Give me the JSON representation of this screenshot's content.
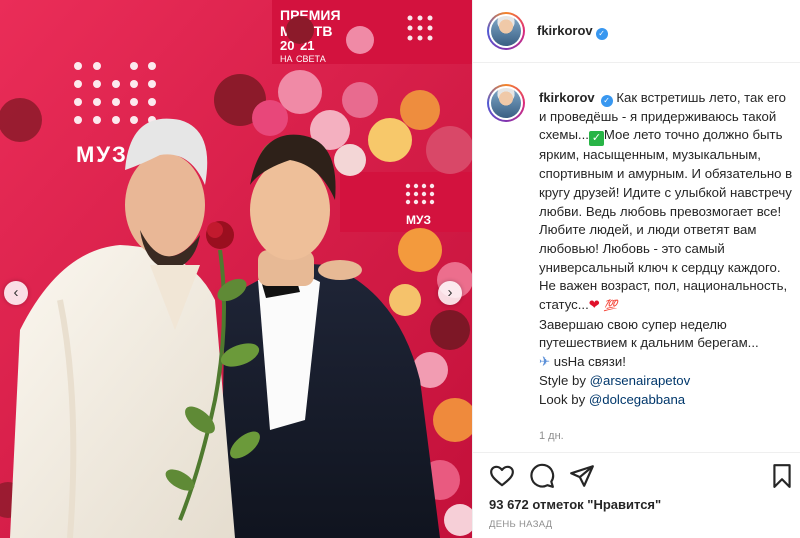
{
  "account": {
    "username": "fkirkorov",
    "verified": true
  },
  "photo": {
    "backdrop_text_1": "ПРЕМИЯ",
    "backdrop_text_2": "МУЗ-ТВ",
    "backdrop_text_3": "20",
    "backdrop_text_4": "21",
    "backdrop_text_5": "НА",
    "backdrop_text_6": "СВЕТА",
    "logo_text": "МУЗ",
    "logo_text_small": "МУЗ",
    "accent_color": "#d81743"
  },
  "caption": {
    "line_1": "Как встретишь лето, так",
    "line_2": "его и проведёшь - я придерживаюсь",
    "line_3a": "такой схемы...",
    "line_3b": "Мое лето точно",
    "line_4": "должно быть ярким, насыщенным,",
    "line_5": "музыкальным, спортивным и",
    "line_6": "амурным. И обязательно в кругу",
    "line_7": "друзей! Идите с улыбкой навстречу",
    "line_8": "любви. Ведь любовь превозмогает",
    "line_9": "все! Любите людей, и люди ответят",
    "line_10": "вам любовью! Любовь - это самый",
    "line_11": "универсальный ключ к сердцу",
    "line_12": "каждого. Не важен возраст, пол,",
    "line_13": "национальность, статус...",
    "line_14": "Завершаю свою супер неделю",
    "line_15": "путешествием к дальним берегам...",
    "line_16": "usНа связи!",
    "style_by_label": "Style by",
    "style_by_handle": "@arsenairapetov",
    "look_by_label": "Look by",
    "look_by_handle": "@dolcegabbana",
    "check_glyph": "✓",
    "heart_glyph": "❤",
    "hundred_glyph": "💯",
    "plane_glyph": "✈"
  },
  "time_ago": "1 дн.",
  "likes_text": "93 672 отметок \"Нравится\"",
  "posted_label": "ДЕНЬ НАЗАД",
  "icons": [
    "heart-icon",
    "comment-icon",
    "share-icon",
    "bookmark-icon",
    "chevron-left-icon",
    "chevron-right-icon",
    "verified-badge-icon"
  ]
}
